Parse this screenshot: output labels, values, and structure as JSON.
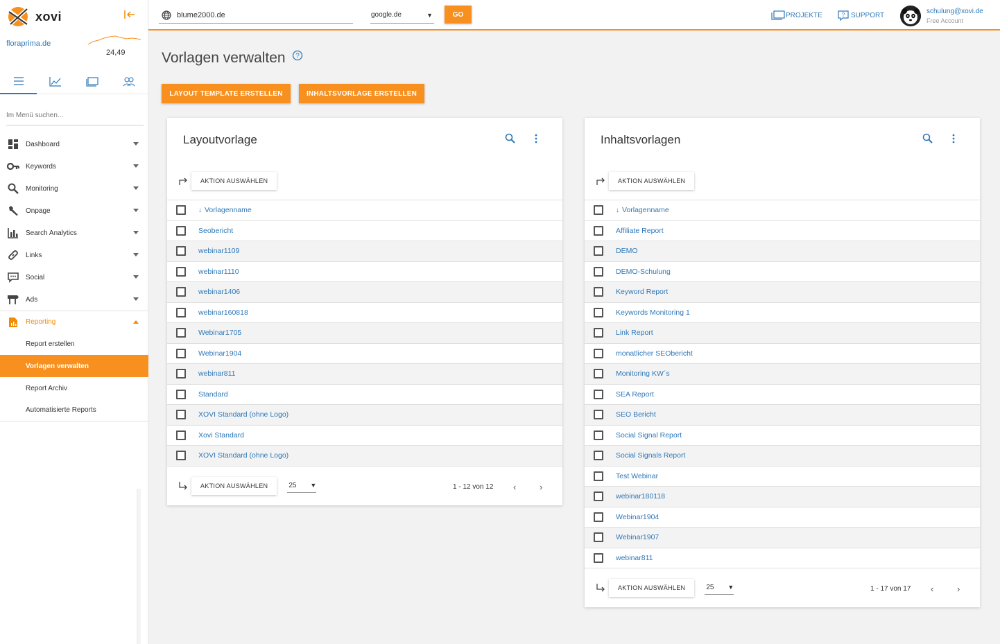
{
  "app": {
    "logo_text": "xovi"
  },
  "sidebar": {
    "project": "floraprima.de",
    "sparkline_value": "24,49",
    "search_placeholder": "Im Menü suchen...",
    "menu": [
      {
        "label": "Dashboard",
        "icon": "dashboard-icon"
      },
      {
        "label": "Keywords",
        "icon": "key-icon"
      },
      {
        "label": "Monitoring",
        "icon": "search-icon"
      },
      {
        "label": "Onpage",
        "icon": "wrench-icon"
      },
      {
        "label": "Search Analytics",
        "icon": "bar-chart-icon"
      },
      {
        "label": "Links",
        "icon": "link-icon"
      },
      {
        "label": "Social",
        "icon": "chat-icon"
      },
      {
        "label": "Ads",
        "icon": "signpost-icon"
      }
    ],
    "reporting": {
      "label": "Reporting",
      "items": [
        "Report erstellen",
        "Vorlagen verwalten",
        "Report Archiv",
        "Automatisierte Reports"
      ],
      "active_index": 1
    }
  },
  "topbar": {
    "domain": "blume2000.de",
    "engine": "google.de",
    "go_label": "GO",
    "projects_label": "PROJEKTE",
    "support_label": "SUPPORT",
    "user_email": "schulung@xovi.de",
    "user_plan": "Free Account"
  },
  "page": {
    "title": "Vorlagen verwalten",
    "btn_layout": "LAYOUT TEMPLATE ERSTELLEN",
    "btn_content": "INHALTSVORLAGE ERSTELLEN"
  },
  "layout_card": {
    "title": "Layoutvorlage",
    "action_label": "AKTION AUSWÄHLEN",
    "column": "Vorlagenname",
    "rows": [
      "Seobericht",
      "webinar1109",
      "webinar1110",
      "webinar1406",
      "webinar160818",
      "Webinar1705",
      "Webinar1904",
      "webinar811",
      "Standard",
      "XOVI Standard (ohne Logo)",
      "Xovi Standard",
      "XOVI Standard (ohne Logo)"
    ],
    "page_size": "25",
    "page_info": "1 - 12 von 12"
  },
  "content_card": {
    "title": "Inhaltsvorlagen",
    "action_label": "AKTION AUSWÄHLEN",
    "column": "Vorlagenname",
    "rows": [
      "Affiliate Report",
      "DEMO",
      "DEMO-Schulung",
      "Keyword Report",
      "Keywords Monitoring 1",
      "Link Report",
      "monatlicher SEObericht",
      "Monitoring KW´s",
      "SEA Report",
      "SEO Bericht",
      "Social Signal Report",
      "Social Signals Report",
      "Test Webinar",
      "webinar180118",
      "Webinar1904",
      "Webinar1907",
      "webinar811"
    ],
    "page_size": "25",
    "page_info": "1 - 17 von 17"
  },
  "colors": {
    "accent": "#f7901e",
    "link": "#2e78b9"
  }
}
